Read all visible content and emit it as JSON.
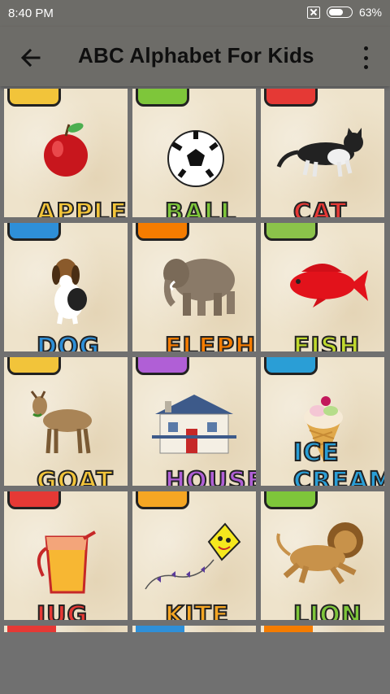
{
  "status": {
    "time": "8:40 PM",
    "battery": "63%"
  },
  "app_bar": {
    "title": "ABC Alphabet For Kids",
    "back_icon": "arrow-left-icon",
    "menu_icon": "more-vertical-icon"
  },
  "cards": [
    {
      "word": "APPLE",
      "picture": "apple",
      "letter_color": "#f2c43a",
      "word_color": "#f2c43a"
    },
    {
      "word": "BALL",
      "picture": "ball",
      "letter_color": "#7ec63a",
      "word_color": "#7ec63a"
    },
    {
      "word": "CAT",
      "picture": "cat",
      "letter_color": "#e53935",
      "word_color": "#e53935"
    },
    {
      "word": "DOG",
      "picture": "dog",
      "letter_color": "#2e8fd8",
      "word_color": "#2e8fd8"
    },
    {
      "word": "ELEPHANT",
      "picture": "elephant",
      "letter_color": "#f57c00",
      "word_color": "#f57c00"
    },
    {
      "word": "FISH",
      "picture": "fish",
      "letter_color": "#8bc34a",
      "word_color": "#c0d92e"
    },
    {
      "word": "GOAT",
      "picture": "goat",
      "letter_color": "#f2c43a",
      "word_color": "#f2c43a"
    },
    {
      "word": "HOUSE",
      "picture": "house",
      "letter_color": "#b05fd6",
      "word_color": "#b05fd6"
    },
    {
      "word": "ICE CREAM",
      "picture": "ice-cream",
      "letter_color": "#2a9ed6",
      "word_color": "#2a9ed6"
    },
    {
      "word": "JUG",
      "picture": "jug",
      "letter_color": "#e53935",
      "word_color": "#e53935"
    },
    {
      "word": "KITE",
      "picture": "kite",
      "letter_color": "#f5a623",
      "word_color": "#f5a623"
    },
    {
      "word": "LION",
      "picture": "lion",
      "letter_color": "#7ec63a",
      "word_color": "#7ec63a"
    }
  ],
  "partial_cards": [
    {
      "letter_color": "#e53935"
    },
    {
      "letter_color": "#2e8fd8"
    },
    {
      "letter_color": "#f57c00"
    }
  ]
}
